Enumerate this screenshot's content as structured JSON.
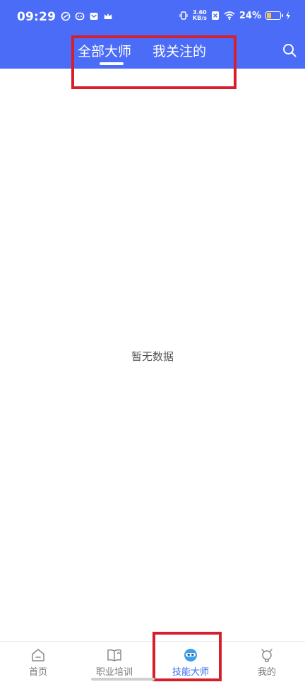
{
  "status_bar": {
    "time": "09:29",
    "net_speed_value": "3.60",
    "net_speed_unit": "KB/s",
    "battery_percent": "24%",
    "battery_level": 0.24,
    "icons": [
      "notification-icon-1",
      "notification-icon-2",
      "mail-icon",
      "crown-icon",
      "vibrate-icon",
      "network-speed-icon",
      "sim-off-icon",
      "wifi-icon",
      "battery-icon",
      "charging-icon"
    ]
  },
  "header": {
    "tabs": [
      {
        "label": "全部大师",
        "active": true
      },
      {
        "label": "我关注的",
        "active": false
      }
    ],
    "search_icon": "search-icon"
  },
  "main": {
    "empty_text": "暂无数据"
  },
  "bottom_nav": {
    "items": [
      {
        "label": "首页",
        "icon": "home-icon",
        "active": false
      },
      {
        "label": "职业培训",
        "icon": "book-icon",
        "active": false
      },
      {
        "label": "技能大师",
        "icon": "master-icon",
        "active": true
      },
      {
        "label": "我的",
        "icon": "profile-icon",
        "active": false
      }
    ]
  },
  "colors": {
    "brand_blue": "#4a6cf7",
    "active_nav": "#3a6df0",
    "highlight_red": "#d61f2c",
    "battery_fill": "#f6c342"
  }
}
